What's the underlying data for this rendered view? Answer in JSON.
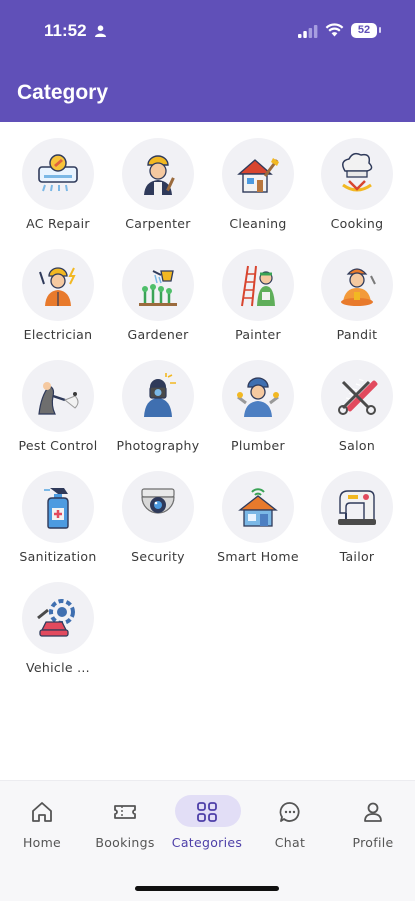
{
  "status": {
    "time": "11:52",
    "battery": "52"
  },
  "header": {
    "title": "Category"
  },
  "categories": [
    {
      "label": "AC Repair",
      "icon": "ac-repair-icon"
    },
    {
      "label": "Carpenter",
      "icon": "carpenter-icon"
    },
    {
      "label": "Cleaning",
      "icon": "cleaning-icon"
    },
    {
      "label": "Cooking",
      "icon": "cooking-icon"
    },
    {
      "label": "Electrician",
      "icon": "electrician-icon"
    },
    {
      "label": "Gardener",
      "icon": "gardener-icon"
    },
    {
      "label": "Painter",
      "icon": "painter-icon"
    },
    {
      "label": "Pandit",
      "icon": "pandit-icon"
    },
    {
      "label": "Pest Control",
      "icon": "pest-control-icon"
    },
    {
      "label": "Photography",
      "icon": "photography-icon"
    },
    {
      "label": "Plumber",
      "icon": "plumber-icon"
    },
    {
      "label": "Salon",
      "icon": "salon-icon"
    },
    {
      "label": "Sanitization",
      "icon": "sanitization-icon"
    },
    {
      "label": "Security",
      "icon": "security-icon"
    },
    {
      "label": "Smart Home",
      "icon": "smart-home-icon"
    },
    {
      "label": "Tailor",
      "icon": "tailor-icon"
    },
    {
      "label": "Vehicle ...",
      "icon": "vehicle-icon"
    }
  ],
  "nav": {
    "active": "Categories",
    "items": [
      {
        "label": "Home",
        "icon": "home-icon"
      },
      {
        "label": "Bookings",
        "icon": "ticket-icon"
      },
      {
        "label": "Categories",
        "icon": "grid-icon"
      },
      {
        "label": "Chat",
        "icon": "chat-icon"
      },
      {
        "label": "Profile",
        "icon": "person-icon"
      }
    ]
  },
  "colors": {
    "primary": "#6050b8",
    "active_pill": "#e2def6",
    "active_text": "#4d3fa8"
  }
}
